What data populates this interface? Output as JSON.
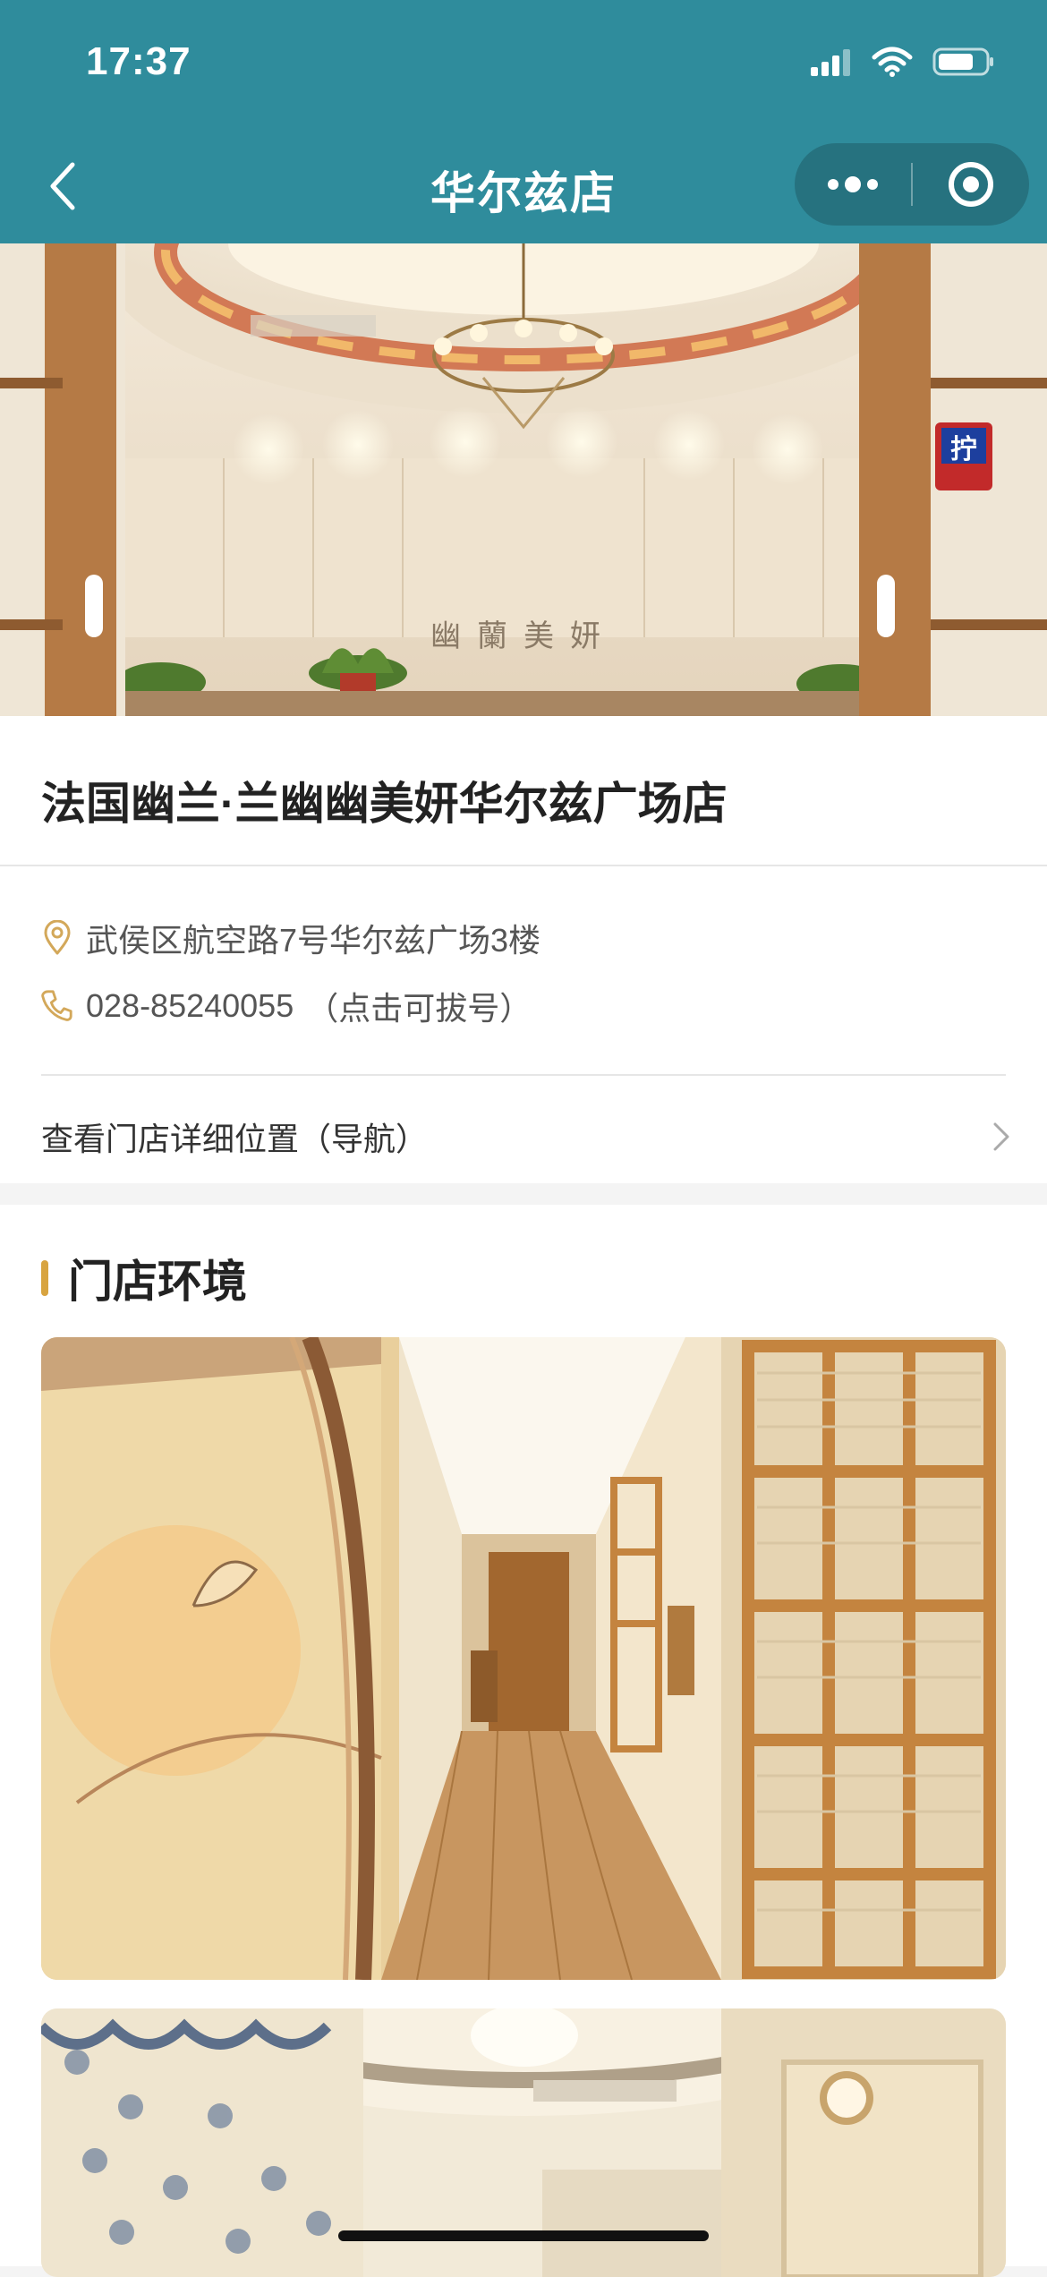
{
  "status_bar": {
    "time": "17:37"
  },
  "nav": {
    "title": "华尔兹店"
  },
  "hero": {
    "sign_text": "幽蘭美妍",
    "side_sign": "拧"
  },
  "store": {
    "name": "法国幽兰·兰幽幽美妍华尔兹广场店",
    "address": "武侯区航空路7号华尔兹广场3楼",
    "phone": "028-85240055",
    "phone_hint": "（点击可拔号）",
    "nav_link": "查看门店详细位置（导航）"
  },
  "environment": {
    "title": "门店环境"
  },
  "colors": {
    "header": "#2f8c9c",
    "accent": "#d8a440",
    "icon_gold": "#d3a85a"
  }
}
